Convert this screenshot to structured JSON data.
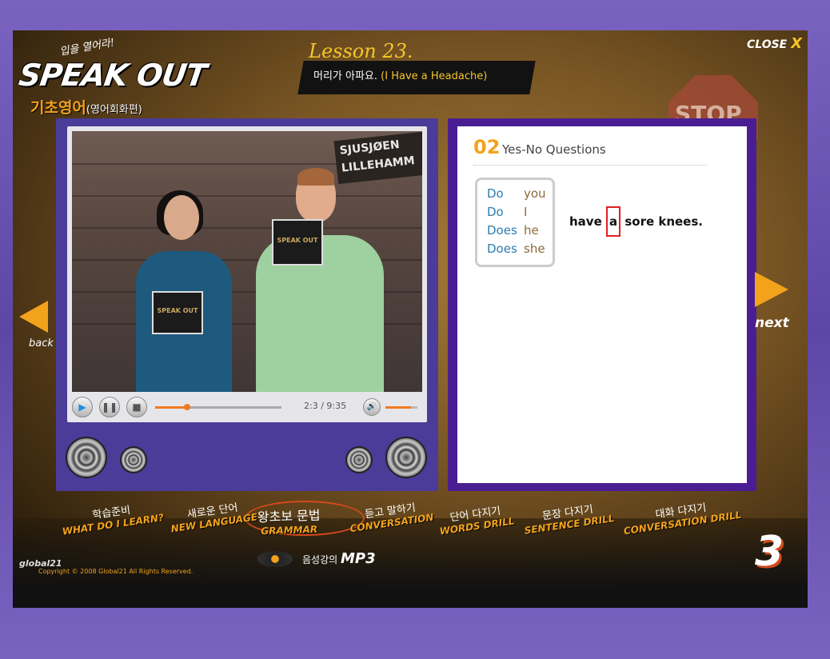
{
  "header": {
    "logo_small": "입을 열어라!",
    "logo": "SPEAK OUT",
    "logo_sub": "기초영어",
    "logo_sub_paren": "(영어회화편)",
    "lesson_number": "Lesson 23.",
    "lesson_title_ko": "머리가 아파요.",
    "lesson_title_en": "(I Have a Headache)",
    "close_label": "CLOSE",
    "close_x": "X",
    "stop_sign": "STOP"
  },
  "video": {
    "sign_text_1": "SJUSJØEN",
    "sign_text_2": "LILLEHAMM",
    "magazine_text": "SPEAK OUT",
    "time": "2:3 / 9:35",
    "progress": 0.25,
    "volume": 0.8
  },
  "lesson": {
    "section_number": "02",
    "section_title": "Yes-No Questions",
    "rows": [
      {
        "aux": "Do",
        "pronoun": "you"
      },
      {
        "aux": "Do",
        "pronoun": "I"
      },
      {
        "aux": "Does",
        "pronoun": "he"
      },
      {
        "aux": "Does",
        "pronoun": "she"
      }
    ],
    "sentence_before": "have ",
    "sentence_highlight": "a",
    "sentence_after": " sore knees."
  },
  "nav": {
    "back_label": "back",
    "next_label": "next"
  },
  "menu": [
    {
      "ko": "학습준비",
      "en": "WHAT DO I LEARN?"
    },
    {
      "ko": "새로운 단어",
      "en": "NEW LANGUAGE"
    },
    {
      "ko": "왕초보 문법",
      "en": "GRAMMAR"
    },
    {
      "ko": "듣고 말하기",
      "en": "CONVERSATION"
    },
    {
      "ko": "단어 다지기",
      "en": "WORDS DRILL"
    },
    {
      "ko": "문장 다지기",
      "en": "SENTENCE DRILL"
    },
    {
      "ko": "대화 다지기",
      "en": "CONVERSATION DRILL"
    }
  ],
  "mp3": {
    "label_ko": "음성강의",
    "label_en": "MP3"
  },
  "page_number": "3",
  "footer": {
    "brand": "global21",
    "copyright": "Copyright © 2008 Global21 All Rights Reserved."
  },
  "colors": {
    "accent": "#f2a21b",
    "frame_left": "#4a3c98",
    "frame_right": "#4a1e92",
    "aux_text": "#2c7cb0",
    "highlight": "#e02020"
  }
}
